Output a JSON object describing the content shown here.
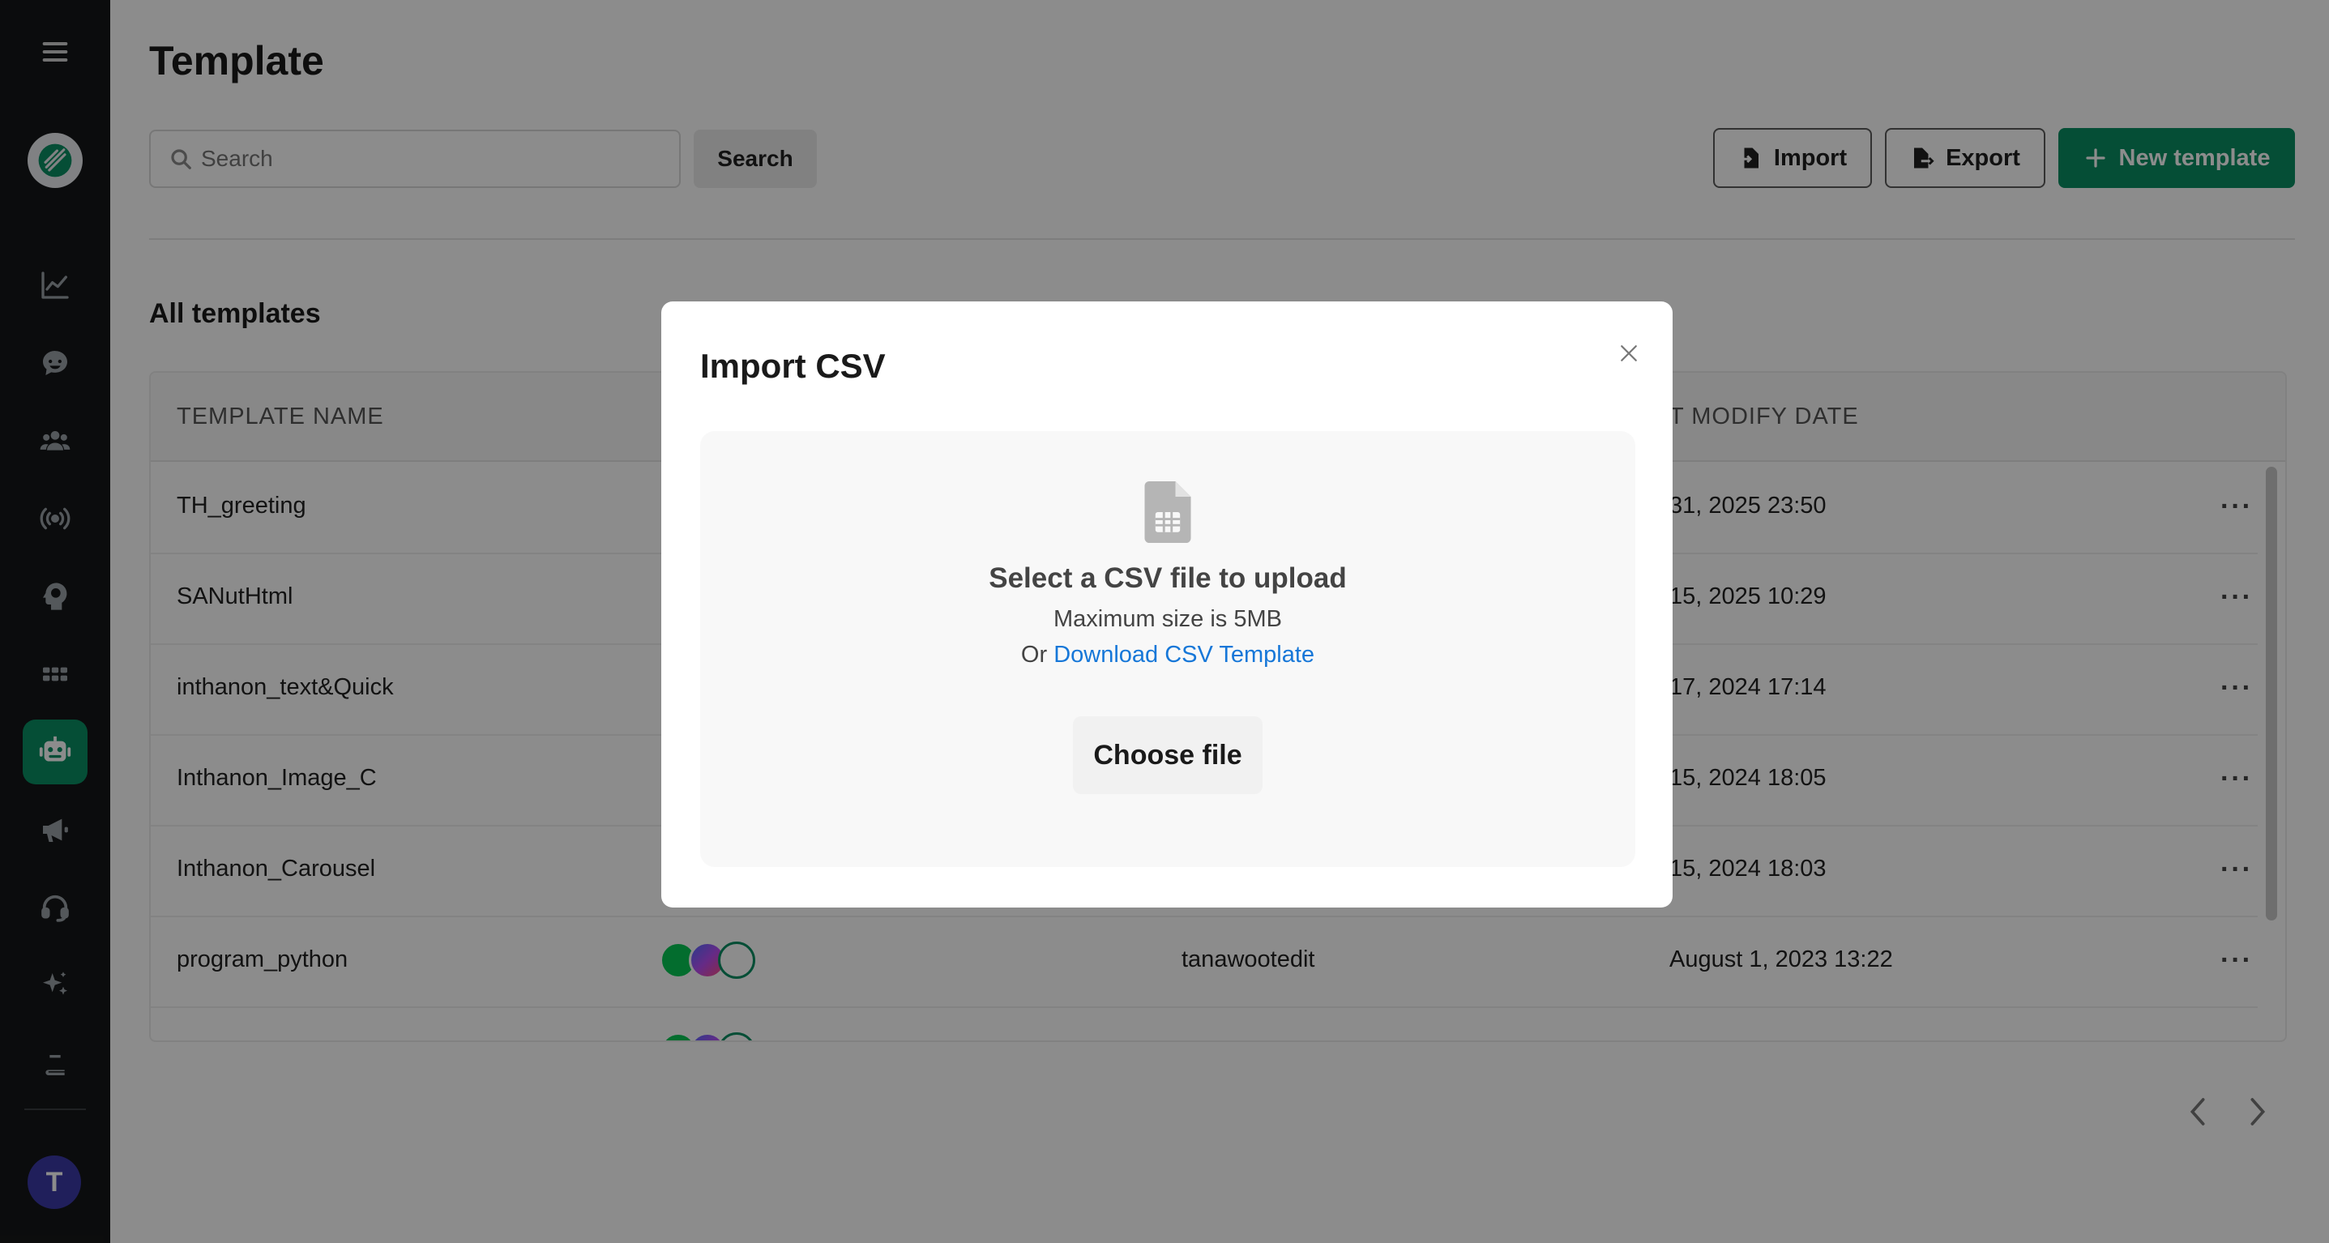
{
  "page": {
    "title": "Template",
    "section_title": "All templates"
  },
  "search": {
    "placeholder": "Search",
    "button_label": "Search"
  },
  "toolbar": {
    "import_label": "Import",
    "export_label": "Export",
    "new_label": "New template"
  },
  "table": {
    "headers": [
      "TEMPLATE NAME",
      "T MODIFY DATE"
    ],
    "rows": [
      {
        "name": "TH_greeting",
        "editor": "",
        "date": "31, 2025 23:50"
      },
      {
        "name": "SANutHtml",
        "editor": "",
        "date": "15, 2025 10:29"
      },
      {
        "name": "inthanon_text&Quick",
        "editor": "",
        "date": "17, 2024 17:14"
      },
      {
        "name": "Inthanon_Image_C",
        "editor": "",
        "date": "15, 2024 18:05"
      },
      {
        "name": "Inthanon_Carousel",
        "editor": "",
        "date": "15, 2024 18:03"
      },
      {
        "name": "program_python",
        "editor": "tanawootedit",
        "date": "August 1, 2023 13:22"
      }
    ],
    "more_label": "···"
  },
  "user": {
    "initial": "T"
  },
  "modal": {
    "title": "Import CSV",
    "dropzone_title": "Select a CSV file to upload",
    "max_size": "Maximum size is 5MB",
    "or_text": "Or ",
    "download_link": "Download CSV Template",
    "choose_button": "Choose file"
  },
  "icons": {
    "sidebar": [
      "hamburger-icon",
      "brand-logo",
      "chart-icon",
      "chat-icon",
      "users-icon",
      "broadcast-icon",
      "brain-icon",
      "apps-icon",
      "robot-icon",
      "megaphone-icon",
      "headset-icon",
      "sparkle-icon",
      "book-icon"
    ]
  },
  "colors": {
    "brand_green": "#0a8f63",
    "sidebar_bg": "#151718",
    "link_blue": "#1677d8",
    "avatar": "#3b3aa6"
  }
}
